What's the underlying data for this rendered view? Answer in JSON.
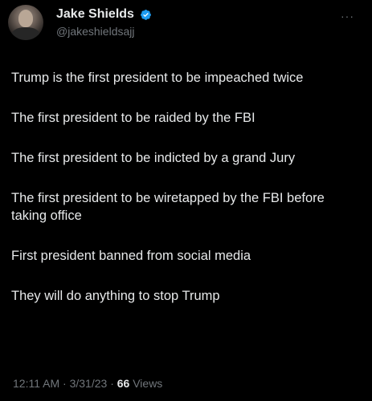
{
  "author": {
    "display_name": "Jake Shields",
    "handle": "@jakeshieldsajj",
    "verified_color": "#1d9bf0"
  },
  "tweet": {
    "paragraphs": [
      "Trump is the first president to be impeached twice",
      "The first president to be raided by the FBI",
      "The first president to be indicted by a grand Jury",
      "The first president to be wiretapped by the FBI before taking office",
      "First president banned from social media",
      "They will do anything to stop Trump"
    ]
  },
  "meta": {
    "time": "12:11 AM",
    "separator": "·",
    "date": "3/31/23",
    "views_count": "66",
    "views_label": "Views"
  },
  "icons": {
    "more": "more-icon",
    "verified": "verified-badge-icon",
    "avatar": "profile-photo"
  },
  "colors": {
    "background": "#000000",
    "text": "#e7e9ea",
    "secondary": "#71767b"
  }
}
